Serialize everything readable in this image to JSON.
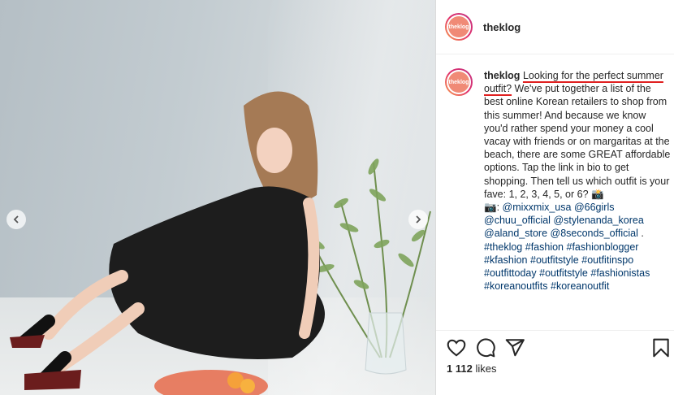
{
  "post": {
    "username": "theklog",
    "avatar_text": "theklog",
    "caption": {
      "username": "theklog",
      "highlight": "Looking for the perfect summer outfit?",
      "body": " We've put together a list of the best online Korean retailers to shop from this summer! And because we know you'd rather spend your money a cool vacay with friends or on margaritas at the beach, there are some GREAT affordable options. Tap the link in bio to get shopping. Then tell us which outfit is your fave: 1, 2, 3, 4, 5, or 6? 📸",
      "camera_emoji": "📷",
      "mentions": [
        "@mixxmix_usa",
        "@66girls",
        "@chuu_official",
        "@stylenanda_korea",
        "@aland_store",
        "@8seconds_official"
      ],
      "mention_end": " .",
      "hashtags": [
        "#theklog",
        "#fashion",
        "#fashionblogger",
        "#kfashion",
        "#outfitstyle",
        "#outfitinspo",
        "#outfittoday",
        "#outfitstyle",
        "#fashionistas",
        "#koreanoutfits",
        "#koreanoutfit"
      ]
    },
    "likes_count": "1 112",
    "likes_label": "likes"
  },
  "icons": {
    "prev": "chevron-left-icon",
    "next": "chevron-right-icon",
    "like": "heart-icon",
    "comment": "comment-icon",
    "share": "send-icon",
    "save": "bookmark-icon"
  },
  "colors": {
    "underline_highlight": "#e02020",
    "link": "#00376b"
  }
}
